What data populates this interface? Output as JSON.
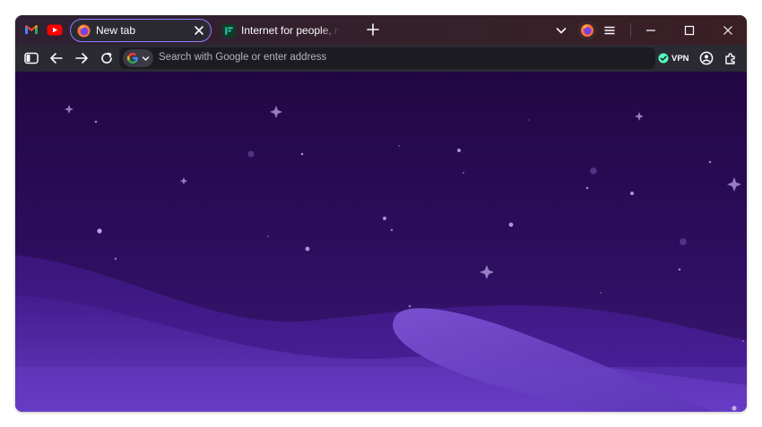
{
  "tabs": {
    "pinned": [
      {
        "name": "gmail",
        "icon": "gmail-icon"
      },
      {
        "name": "youtube",
        "icon": "youtube-icon"
      }
    ],
    "active": {
      "title": "New tab",
      "icon": "firefox-icon"
    },
    "inactive": {
      "title": "Internet for people, not profit",
      "icon": "mozilla-favicon-icon"
    }
  },
  "toolbar": {
    "url_placeholder": "Search with Google or enter address",
    "vpn_label": "VPN"
  },
  "colors": {
    "accent": "#8f7cff",
    "toolbar": "#2b2a33",
    "urlbar": "#1c1b22",
    "vpn_status": "#54ffbd",
    "background_top": "#220744",
    "background_bottom": "#3a1875"
  }
}
